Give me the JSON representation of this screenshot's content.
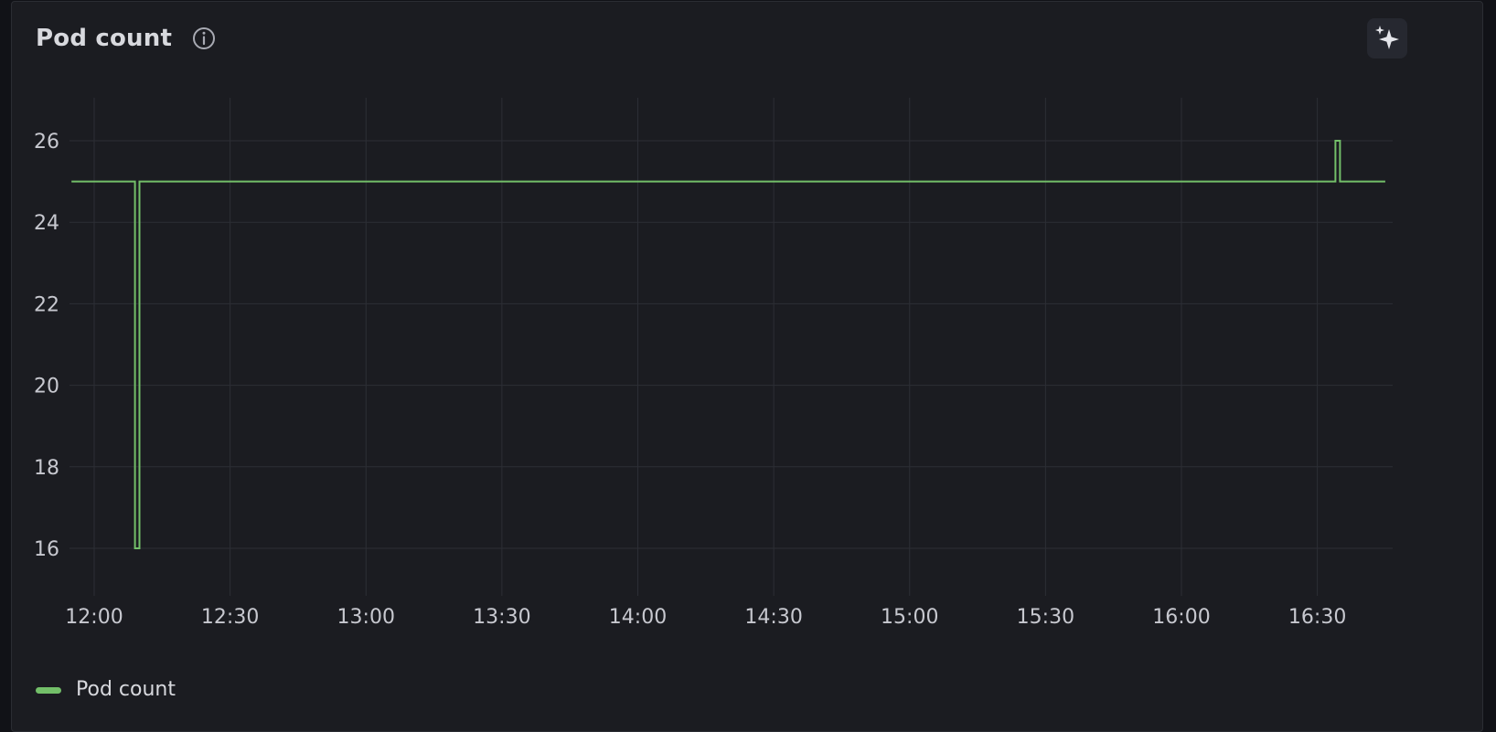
{
  "panel": {
    "title": "Pod count",
    "info_icon": "info-circle-icon",
    "ai_icon": "sparkle-icon"
  },
  "colors": {
    "series": "#73bf69",
    "grid": "#2c2e35",
    "background": "#1b1c21"
  },
  "chart_data": {
    "type": "line",
    "title": "",
    "xlabel": "",
    "ylabel": "",
    "x_ticks": [
      "12:00",
      "12:30",
      "13:00",
      "13:30",
      "14:00",
      "14:30",
      "15:00",
      "15:30",
      "16:00",
      "16:30"
    ],
    "y_ticks": [
      16,
      18,
      20,
      22,
      24,
      26
    ],
    "xlim": [
      "11:55",
      "16:45"
    ],
    "ylim": [
      15,
      27
    ],
    "grid": true,
    "legend_position": "bottom-left",
    "interpolation": "step",
    "series": [
      {
        "name": "Pod count",
        "color": "#73bf69",
        "points": [
          {
            "x": "11:55",
            "y": 25
          },
          {
            "x": "12:09",
            "y": 25
          },
          {
            "x": "12:09",
            "y": 16
          },
          {
            "x": "12:10",
            "y": 16
          },
          {
            "x": "12:10",
            "y": 25
          },
          {
            "x": "16:34",
            "y": 25
          },
          {
            "x": "16:34",
            "y": 26
          },
          {
            "x": "16:35",
            "y": 26
          },
          {
            "x": "16:35",
            "y": 25
          },
          {
            "x": "16:45",
            "y": 25
          }
        ]
      }
    ]
  }
}
